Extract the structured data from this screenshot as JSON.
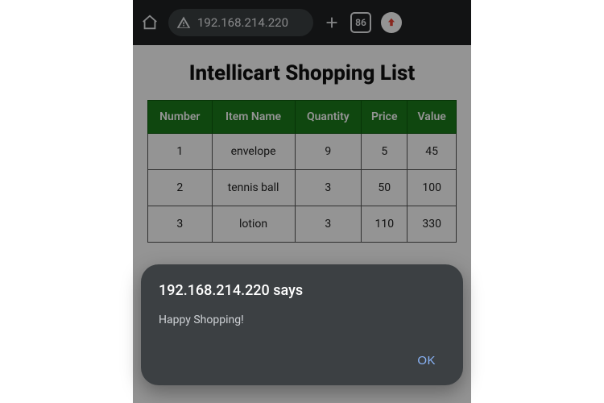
{
  "browser": {
    "url": "192.168.214.220",
    "tab_count": "86"
  },
  "page": {
    "title": "Intellicart Shopping List",
    "columns": [
      "Number",
      "Item Name",
      "Quantity",
      "Price",
      "Value"
    ],
    "rows": [
      {
        "number": "1",
        "name": "envelope",
        "quantity": "9",
        "price": "5",
        "value": "45"
      },
      {
        "number": "2",
        "name": "tennis ball",
        "quantity": "3",
        "price": "50",
        "value": "100"
      },
      {
        "number": "3",
        "name": "lotion",
        "quantity": "3",
        "price": "110",
        "value": "330"
      }
    ]
  },
  "alert": {
    "title": "192.168.214.220 says",
    "message": "Happy Shopping!",
    "ok_label": "OK"
  }
}
